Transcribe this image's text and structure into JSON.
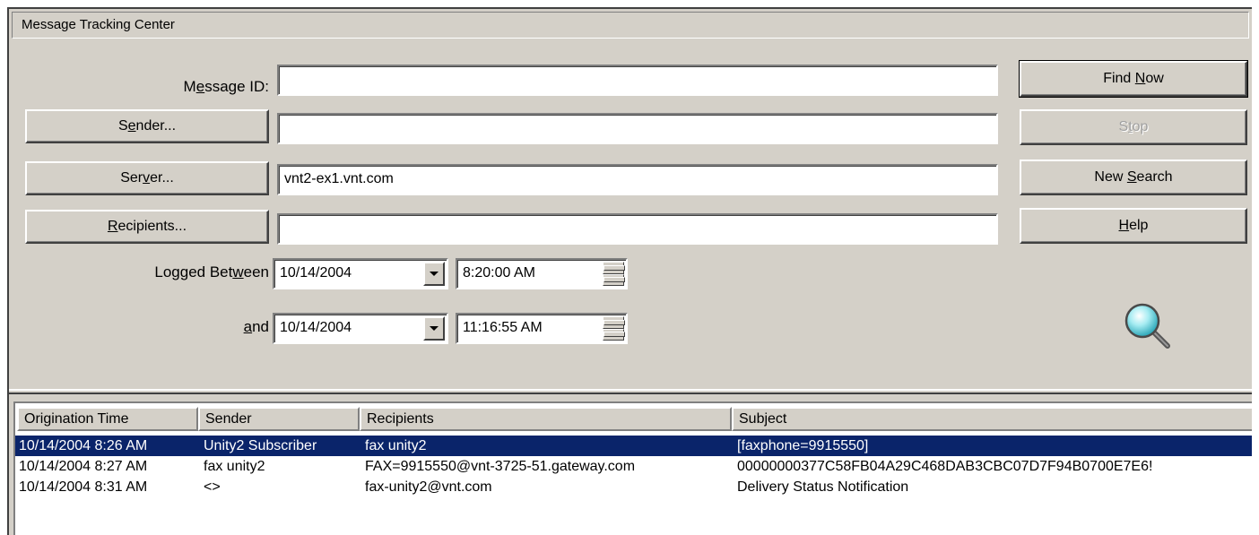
{
  "window": {
    "title": "Message Tracking Center"
  },
  "fields": {
    "message_id": {
      "label_pre": "M",
      "label_ul": "e",
      "label_post": "ssage ID:",
      "value": ""
    },
    "sender": {
      "value": ""
    },
    "server": {
      "value": "vnt2-ex1.vnt.com"
    },
    "recipients": {
      "value": ""
    }
  },
  "buttons": {
    "sender": {
      "pre": "S",
      "ul": "e",
      "post": "nder..."
    },
    "server": {
      "pre": "Ser",
      "ul": "v",
      "post": "er..."
    },
    "recipients": {
      "pre": "",
      "ul": "R",
      "post": "ecipients..."
    },
    "find_now": {
      "pre": "Find ",
      "ul": "N",
      "post": "ow"
    },
    "stop": {
      "pre": "S",
      "ul": "t",
      "post": "op"
    },
    "new_search": {
      "pre": "New ",
      "ul": "S",
      "post": "earch"
    },
    "help": {
      "pre": "",
      "ul": "H",
      "post": "elp"
    }
  },
  "logged": {
    "between_pre": "Logged Bet",
    "between_ul": "w",
    "between_post": "een",
    "and_pre": "",
    "and_ul": "a",
    "and_post": "nd",
    "from_date": "10/14/2004",
    "from_time": "8:20:00 AM",
    "to_date": "10/14/2004",
    "to_time": "11:16:55 AM"
  },
  "icons": {
    "search": "magnifier-icon"
  },
  "table": {
    "columns": [
      "Origination Time",
      "Sender",
      "Recipients",
      "Subject"
    ],
    "rows": [
      {
        "time": "10/14/2004  8:26 AM",
        "sender": "Unity2 Subscriber",
        "recipients": "fax unity2",
        "subject": "[faxphone=9915550]"
      },
      {
        "time": "10/14/2004  8:27 AM",
        "sender": "fax unity2",
        "recipients": "FAX=9915550@vnt-3725-51.gateway.com",
        "subject": "00000000377C58FB04A29C468DAB3CBC07D7F94B0700E7E6!"
      },
      {
        "time": "10/14/2004  8:31 AM",
        "sender": "<>",
        "recipients": "fax-unity2@vnt.com",
        "subject": "Delivery Status Notification"
      }
    ]
  },
  "colors": {
    "selection": "#0a246a",
    "face": "#d4d0c8"
  }
}
